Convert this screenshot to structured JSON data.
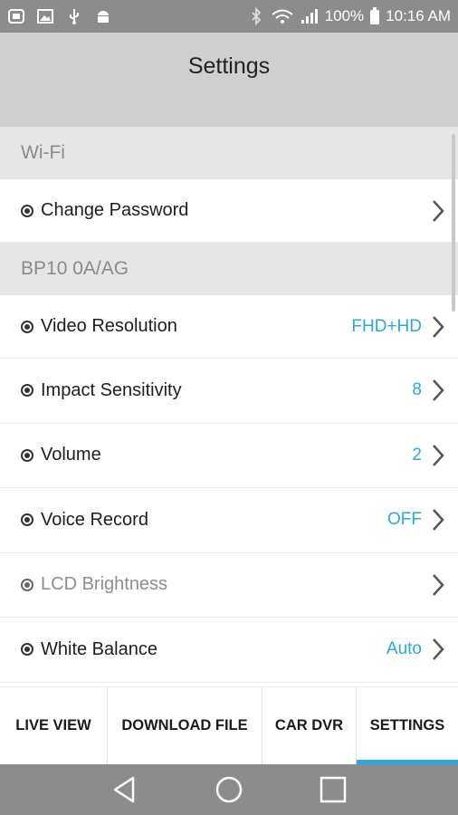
{
  "status": {
    "battery_percent": "100%",
    "time": "10:16 AM"
  },
  "header": {
    "title": "Settings"
  },
  "sections": [
    {
      "title": "Wi-Fi",
      "rows": [
        {
          "label": "Change Password",
          "value": "",
          "enabled": true
        }
      ]
    },
    {
      "title": "BP10 0A/AG",
      "rows": [
        {
          "label": "Video Resolution",
          "value": "FHD+HD",
          "enabled": true
        },
        {
          "label": "Impact Sensitivity",
          "value": "8",
          "enabled": true
        },
        {
          "label": "Volume",
          "value": "2",
          "enabled": true
        },
        {
          "label": "Voice Record",
          "value": "OFF",
          "enabled": true
        },
        {
          "label": "LCD Brightness",
          "value": "",
          "enabled": false
        },
        {
          "label": "White Balance",
          "value": "Auto",
          "enabled": true
        }
      ]
    }
  ],
  "tabs": [
    {
      "label": "LIVE VIEW",
      "active": false
    },
    {
      "label": "DOWNLOAD FILE",
      "active": false
    },
    {
      "label": "CAR DVR",
      "active": false
    },
    {
      "label": "SETTINGS",
      "active": true
    }
  ],
  "colors": {
    "accent": "#29a8e0",
    "status_bar": "#8c8c8c",
    "header": "#cfcfcf",
    "section_header": "#e6e6e6"
  },
  "icons": {
    "status_left": [
      "app-icon",
      "image-icon",
      "usb-icon",
      "android-icon"
    ],
    "status_right": [
      "bluetooth-icon",
      "wifi-icon",
      "signal-icon",
      "battery-icon"
    ],
    "nav": [
      "back-icon",
      "home-icon",
      "recents-icon"
    ]
  }
}
